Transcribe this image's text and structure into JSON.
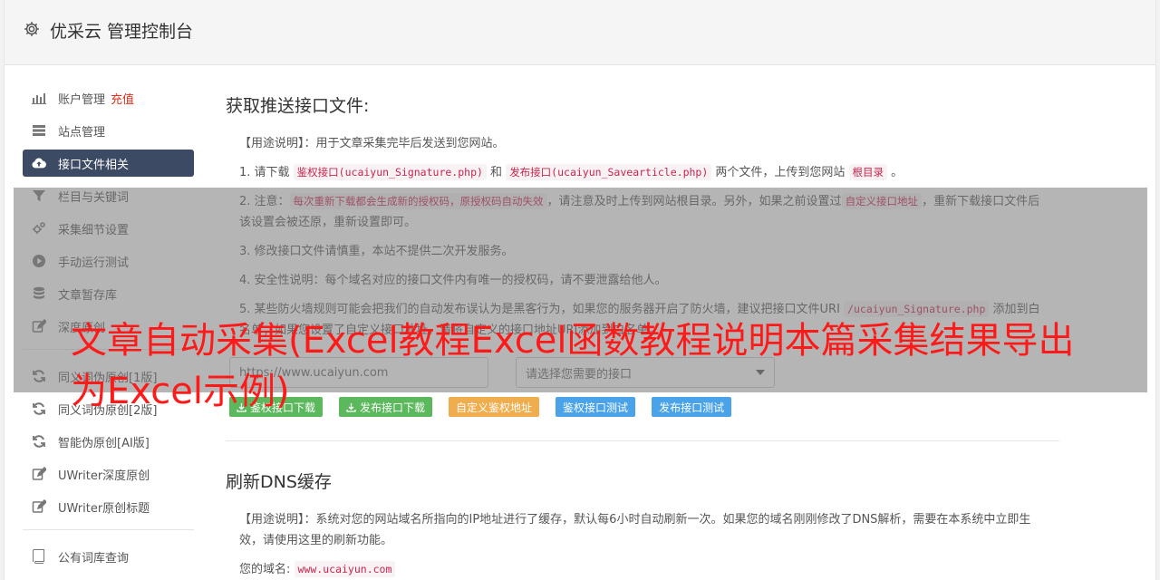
{
  "header": {
    "title": "优采云 管理控制台"
  },
  "sidebar": {
    "items": [
      {
        "label": "账户管理",
        "badge": "充值",
        "icon": "bar-chart-icon"
      },
      {
        "label": "站点管理",
        "icon": "server-icon"
      },
      {
        "label": "接口文件相关",
        "icon": "cloud-upload-icon",
        "active": true
      },
      {
        "label": "栏目与关键词",
        "icon": "filter-icon"
      },
      {
        "label": "采集细节设置",
        "icon": "cogs-icon"
      },
      {
        "label": "手动运行测试",
        "icon": "play-circle-icon"
      },
      {
        "label": "文章暂存库",
        "icon": "database-icon"
      },
      {
        "label": "深度原创",
        "icon": "edit-icon"
      },
      {
        "label": "同义词伪原创[1版]",
        "icon": "refresh-icon"
      },
      {
        "label": "同义词伪原创[2版]",
        "icon": "refresh-icon"
      },
      {
        "label": "智能伪原创[AI版]",
        "icon": "refresh-icon"
      },
      {
        "label": "UWriter深度原创",
        "icon": "edit-icon"
      },
      {
        "label": "UWriter原创标题",
        "icon": "edit-icon"
      },
      {
        "label": "公有词库查询",
        "icon": "book-icon"
      }
    ]
  },
  "section1": {
    "title": "获取推送接口文件:",
    "usage": "【用途说明】：用于文章采集完毕后发送到您网站。",
    "p1": {
      "a": "1. 请下载 ",
      "c1": "鉴权接口(ucaiyun_Signature.php)",
      "b": " 和 ",
      "c2": "发布接口(ucaiyun_Savearticle.php)",
      "c": " 两个文件，上传到您网站 ",
      "c3": "根目录",
      "d": " 。"
    },
    "p2": {
      "a": "2. 注意：",
      "c1": "每次重新下载都会生成新的授权码，原授权码自动失效",
      "b": "，请注意及时上传到网站根目录。另外，如果之前设置过",
      "c2": "自定义接口地址",
      "c": "，重新下载接口文件后该设置会被还原，重新设置即可。"
    },
    "p3": "3. 修改接口文件请慎重，本站不提供二次开发服务。",
    "p4": "4. 安全性说明：每个域名对应的接口文件内有唯一的授权码，请不要泄露给他人。",
    "p5": {
      "a": "5. 某些防火墙规则可能会把我们的自动发布误认为是黑客行为，如果您的服务器开启了防火墙，建议把接口文件URI ",
      "c1": "/ucaiyun_Signature.php",
      "b": " 添加到白名单；如果您设置了自定义接口地址，请将自定义的接口地址URI添加到白名单。"
    },
    "url_value": "https://www.ucaiyun.com",
    "select_placeholder": "请选择您需要的接口",
    "buttons": [
      "鉴权接口下载",
      "发布接口下载",
      "自定义鉴权地址",
      "鉴权接口测试",
      "发布接口测试"
    ]
  },
  "section2": {
    "title": "刷新DNS缓存",
    "usage": "【用途说明】：系统对您的网站域名所指向的IP地址进行了缓存，默认每6小时自动刷新一次。如果您的域名刚刚修改了DNS解析，需要在本系统中立即生效，请使用这里的刷新功能。",
    "domain_label": "您的域名:",
    "domain_value": "www.ucaiyun.com"
  },
  "watermark": "文章自动采集(Excel教程Excel函数教程说明本篇采集结果导出为Excel示例)",
  "colors": {
    "active_nav": "#3d4a63",
    "badge": "#e0301e",
    "code": "#c7254e",
    "watermark": "#ff1a1a"
  }
}
